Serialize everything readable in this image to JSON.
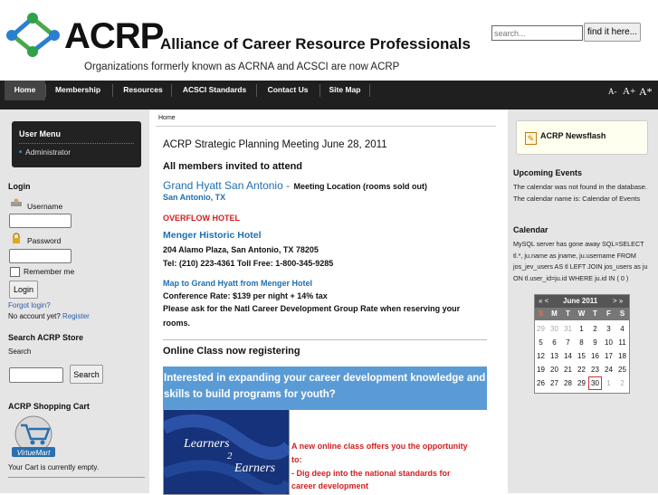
{
  "header": {
    "logo_word": "ACRP",
    "org_name": "Alliance of Career Resource Professionals",
    "tagline": "Organizations formerly known as ACRNA and ACSCI are now ACRP",
    "search_placeholder": "search...",
    "search_button": "find it here..."
  },
  "nav": {
    "items": [
      "Home",
      "Membership",
      "Resources",
      "ACSCI Standards",
      "Contact Us",
      "Site Map"
    ],
    "font_sizes": [
      "A-",
      "A+",
      "A*"
    ]
  },
  "left": {
    "user_menu": {
      "title": "User Menu",
      "item": "Administrator"
    },
    "login": {
      "heading": "Login",
      "username_label": "Username",
      "password_label": "Password",
      "remember_label": "Remember me",
      "login_button": "Login",
      "forgot_link": "Forgot login?",
      "no_account": "No account yet?",
      "register_link": "Register"
    },
    "store": {
      "heading": "Search ACRP Store",
      "label": "Search",
      "button": "Search"
    },
    "cart": {
      "heading": "ACRP Shopping Cart",
      "logo_text": "VirtueMart",
      "empty_text": "Your Cart is currently empty."
    }
  },
  "center": {
    "breadcrumb": "Home",
    "title": "ACRP Strategic Planning Meeting June 28, 2011",
    "invite": "All members invited to attend",
    "hotel1": "Grand Hyatt San Antonio -",
    "hotel1_note": "Meeting Location (rooms sold out)",
    "hotel1_city": "San Antonio, TX",
    "overflow": "OVERFLOW HOTEL",
    "hotel2": "Menger Historic Hotel",
    "hotel2_addr": "204 Alamo Plaza, San Antonio, TX 78205",
    "hotel2_tel": "Tel: (210) 223-4361 Toll Free: 1-800-345-9285",
    "map_link": "Map to Grand Hyatt from Menger Hotel",
    "rate": "Conference Rate: $139 per night + 14% tax",
    "ask_line1": "Please ask for the Natl Career Development Group Rate when reserving your",
    "ask_line2": "rooms.",
    "online_class": "Online Class now registering",
    "banner_line1": "Interested in expanding your career development knowledge and",
    "banner_line2": "skills to build programs for youth?",
    "book_word1": "Learners",
    "book_num": "2",
    "book_word2": "Earners",
    "promo_line1": "A new online class offers you the opportunity",
    "promo_line2": "to:",
    "promo_line3": "- Dig deep into the national standards for",
    "promo_line4": "career development"
  },
  "right": {
    "newsflash": "ACRP Newsflash",
    "upcoming_heading": "Upcoming Events",
    "upcoming_text": "The calendar was not found in the database. The calendar name is: Calendar of Events",
    "calendar_heading": "Calendar",
    "calendar_error": "MySQL server has gone away SQL=SELECT tl.*, ju.name as jname, ju.username FROM jos_jev_users AS tl LEFT JOIN jos_users as ju ON tl.user_id=ju.id WHERE ju.id IN ( 0 )",
    "calendar": {
      "prev": "« <",
      "month": "June 2011",
      "next": "> »",
      "day_names": [
        "S",
        "M",
        "T",
        "W",
        "T",
        "F",
        "S"
      ],
      "weeks": [
        [
          "29",
          "30",
          "31",
          "1",
          "2",
          "3",
          "4"
        ],
        [
          "5",
          "6",
          "7",
          "8",
          "9",
          "10",
          "11"
        ],
        [
          "12",
          "13",
          "14",
          "15",
          "16",
          "17",
          "18"
        ],
        [
          "19",
          "20",
          "21",
          "22",
          "23",
          "24",
          "25"
        ],
        [
          "26",
          "27",
          "28",
          "29",
          "30",
          "1",
          "2"
        ]
      ],
      "today": "30"
    }
  },
  "colors": {
    "nav_bg": "#1f1f1f",
    "accent_blue": "#1f6fb0",
    "alert_red": "#d42020",
    "banner_blue": "#5b9bd5"
  }
}
